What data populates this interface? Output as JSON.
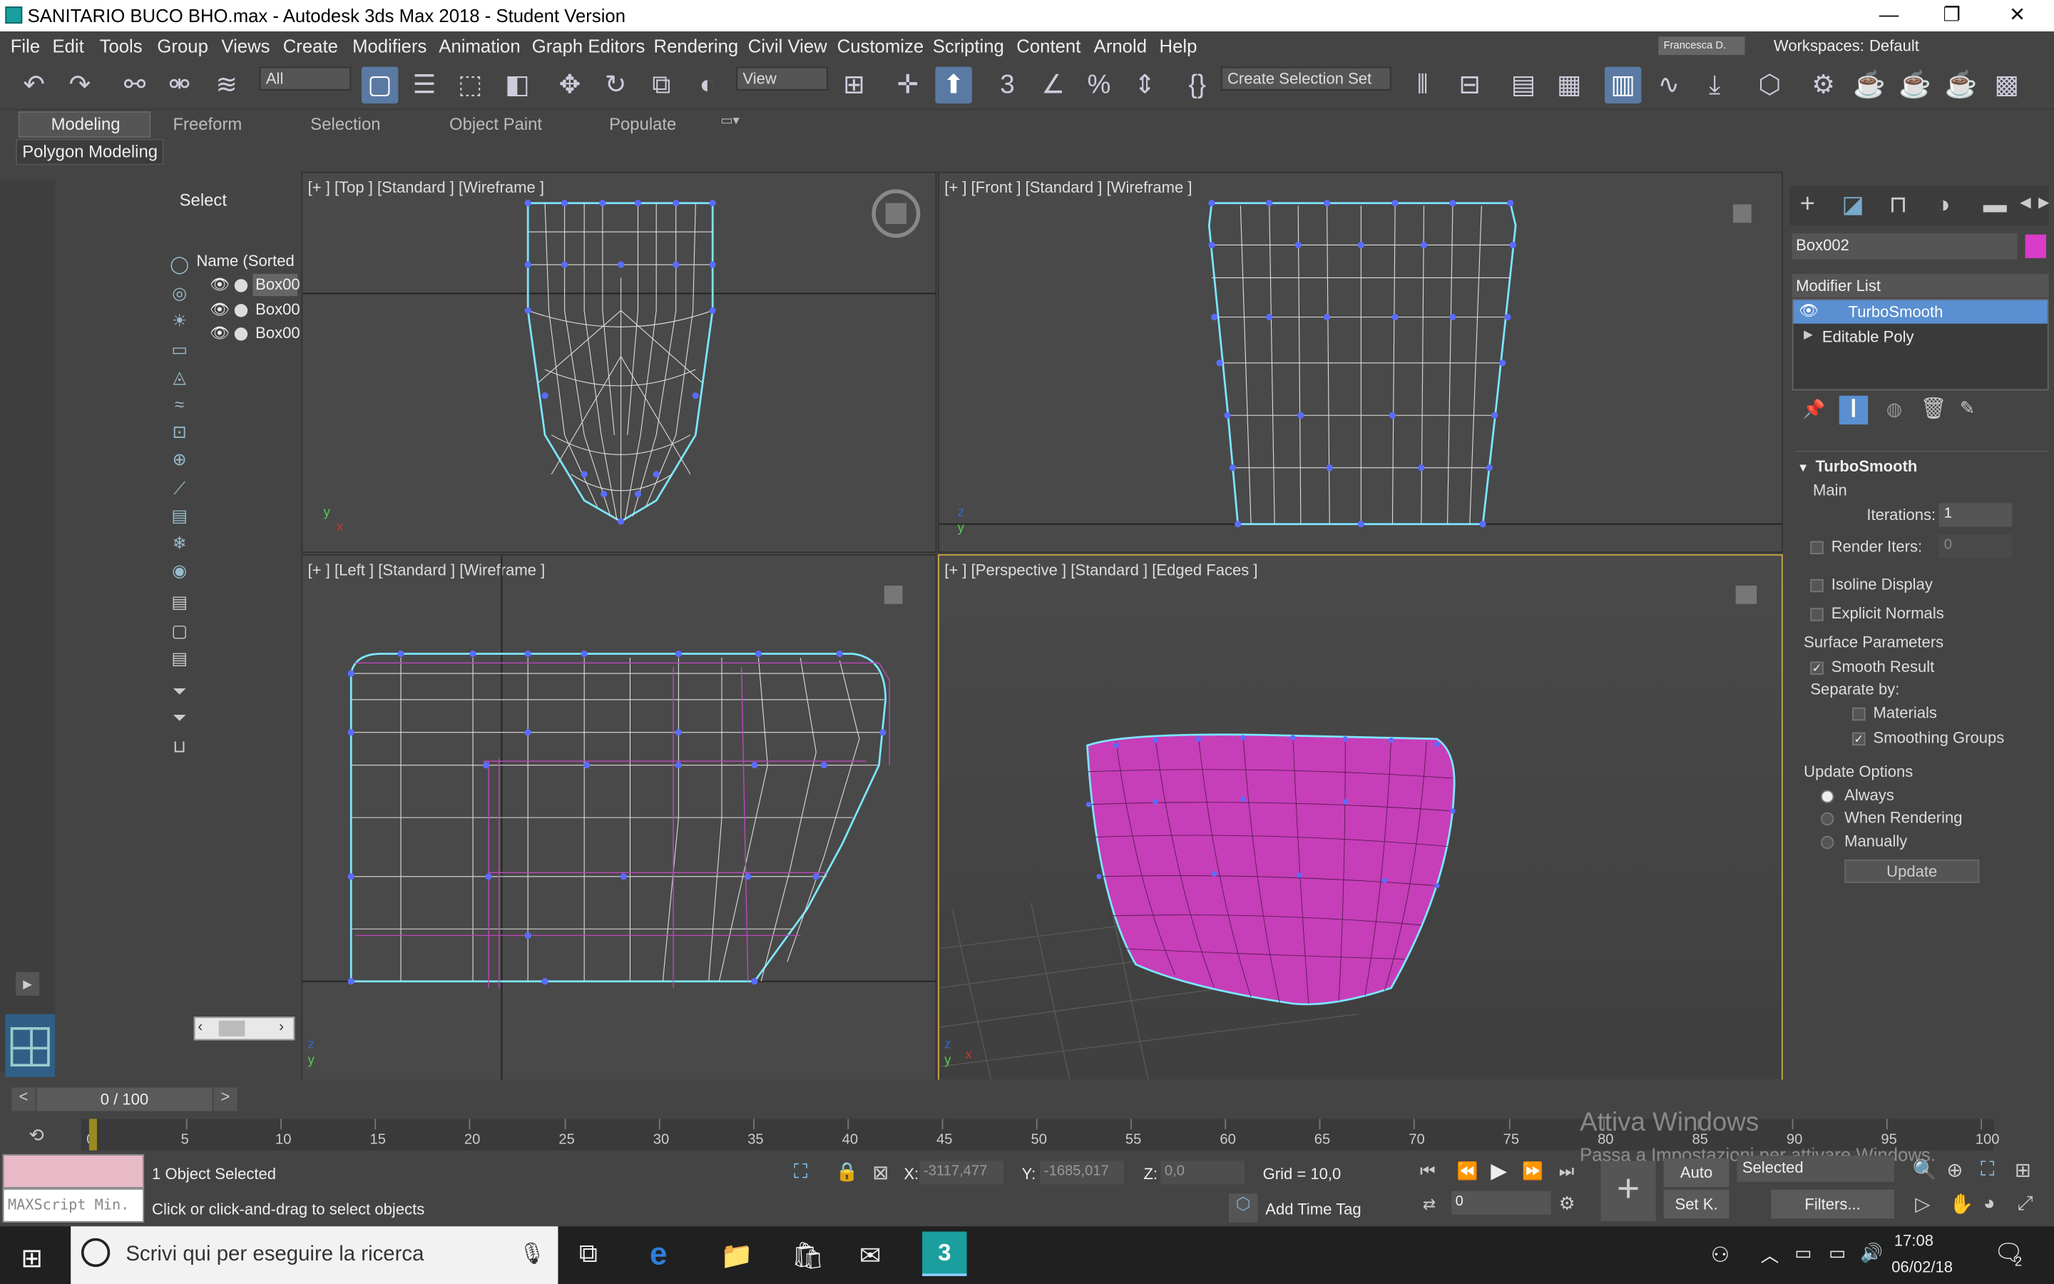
{
  "window": {
    "title": "SANITARIO BUCO BHO.max - Autodesk 3ds Max 2018 - Student Version",
    "minimize": "—",
    "maximize": "❐",
    "close": "✕"
  },
  "menu": [
    "File",
    "Edit",
    "Tools",
    "Group",
    "Views",
    "Create",
    "Modifiers",
    "Animation",
    "Graph Editors",
    "Rendering",
    "Civil View",
    "Customize",
    "Scripting",
    "Content",
    "Arnold",
    "Help"
  ],
  "account": {
    "user": "Francesca D.",
    "workspaces_label": "Workspaces:",
    "workspace": "Default"
  },
  "toolbar": {
    "filter": "All",
    "refcoord": "View",
    "selection_set": "Create Selection Set"
  },
  "ribbon": {
    "tabs": [
      "Modeling",
      "Freeform",
      "Selection",
      "Object Paint",
      "Populate"
    ],
    "subtab": "Polygon Modeling"
  },
  "scene_explorer": {
    "title": "Select",
    "column": "Name (Sorted",
    "items": [
      "Box00",
      "Box00",
      "Box00"
    ]
  },
  "viewports": {
    "top": "[+ ]  [Top ]  [Standard ]  [Wireframe ]",
    "front": "[+ ]  [Front ]  [Standard ]  [Wireframe ]",
    "left": "[+ ]  [Left ]  [Standard ]  [Wireframe ]",
    "persp": "[+ ]  [Perspective ]  [Standard ]  [Edged Faces ]"
  },
  "command_panel": {
    "object_name": "Box002",
    "object_color": "#d83cc8",
    "modifier_list": "Modifier List",
    "stack": [
      "TurboSmooth",
      "Editable Poly"
    ],
    "rollout": "TurboSmooth",
    "main": "Main",
    "iterations_label": "Iterations:",
    "iterations": "1",
    "render_iters_label": "Render Iters:",
    "render_iters": "0",
    "isoline": "Isoline Display",
    "explicit": "Explicit Normals",
    "surface_params": "Surface Parameters",
    "smooth_result": "Smooth Result",
    "separate_by": "Separate by:",
    "materials": "Materials",
    "smoothing_groups": "Smoothing Groups",
    "update_options": "Update Options",
    "always": "Always",
    "when_rendering": "When Rendering",
    "manually": "Manually",
    "update": "Update"
  },
  "timeline": {
    "frame": "0 / 100",
    "prev": "<",
    "next": ">",
    "ticks": [
      "0",
      "5",
      "10",
      "15",
      "20",
      "25",
      "30",
      "35",
      "40",
      "45",
      "50",
      "55",
      "60",
      "65",
      "70",
      "75",
      "80",
      "85",
      "90",
      "95",
      "100"
    ]
  },
  "status": {
    "maxscript": "MAXScript Min.",
    "selected": "1 Object Selected",
    "prompt": "Click or click-and-drag to select objects",
    "x_label": "X:",
    "x": "-3117,477",
    "y_label": "Y:",
    "y": "-1685,017",
    "z_label": "Z:",
    "z": "0,0",
    "grid": "Grid = 10,0",
    "add_time_tag": "Add Time Tag",
    "auto": "Auto",
    "set_key": "Set K.",
    "key_filter": "Selected",
    "filters": "Filters...",
    "frame_field": "0"
  },
  "watermark": {
    "line1": "Attiva Windows",
    "line2": "Passa a Impostazioni per attivare Windows."
  },
  "taskbar": {
    "search": "Scrivi qui per eseguire la ricerca",
    "time": "17:08",
    "date": "06/02/18",
    "notif": "2"
  }
}
